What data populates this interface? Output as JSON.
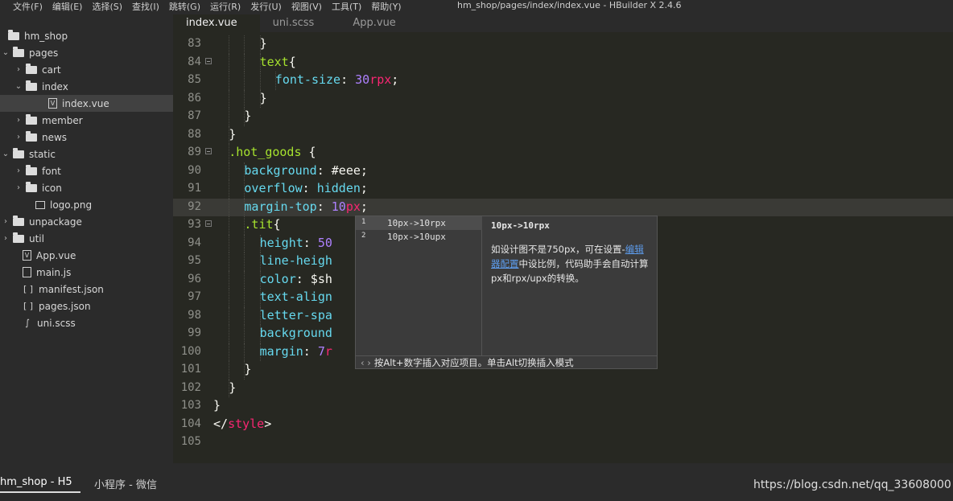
{
  "menu": [
    "文件(F)",
    "编辑(E)",
    "选择(S)",
    "查找(I)",
    "跳转(G)",
    "运行(R)",
    "发行(U)",
    "视图(V)",
    "工具(T)",
    "帮助(Y)"
  ],
  "window_title": "hm_shop/pages/index/index.vue - HBuilder X 2.4.6",
  "tabs": [
    "index.vue",
    "uni.scss",
    "App.vue"
  ],
  "tree": [
    {
      "label": "hm_shop",
      "type": "folder-open",
      "chev": "",
      "icon": "folder-icon"
    },
    {
      "label": "pages",
      "type": "folder-open",
      "chev": "⌄",
      "icon": "folder-open-icon"
    },
    {
      "label": "cart",
      "type": "folder",
      "chev": "›",
      "icon": "folder-icon"
    },
    {
      "label": "index",
      "type": "folder-open",
      "chev": "⌄",
      "icon": "folder-open-icon"
    },
    {
      "label": "index.vue",
      "type": "vue",
      "chev": "",
      "icon": "vue-file-icon"
    },
    {
      "label": "member",
      "type": "folder",
      "chev": "›",
      "icon": "folder-icon"
    },
    {
      "label": "news",
      "type": "folder",
      "chev": "›",
      "icon": "folder-icon"
    },
    {
      "label": "static",
      "type": "folder-open",
      "chev": "⌄",
      "icon": "folder-open-icon"
    },
    {
      "label": "font",
      "type": "folder",
      "chev": "›",
      "icon": "folder-icon"
    },
    {
      "label": "icon",
      "type": "folder",
      "chev": "›",
      "icon": "folder-icon"
    },
    {
      "label": "logo.png",
      "type": "img",
      "chev": "",
      "icon": "image-file-icon"
    },
    {
      "label": "unpackage",
      "type": "folder",
      "chev": "›",
      "icon": "folder-icon"
    },
    {
      "label": "util",
      "type": "folder",
      "chev": "›",
      "icon": "folder-icon"
    },
    {
      "label": "App.vue",
      "type": "vue",
      "chev": "",
      "icon": "vue-file-icon"
    },
    {
      "label": "main.js",
      "type": "js",
      "chev": "",
      "icon": "js-file-icon"
    },
    {
      "label": "manifest.json",
      "type": "json",
      "chev": "",
      "icon": "json-file-icon"
    },
    {
      "label": "pages.json",
      "type": "json",
      "chev": "",
      "icon": "json-file-icon"
    },
    {
      "label": "uni.scss",
      "type": "scss",
      "chev": "",
      "icon": "scss-file-icon"
    }
  ],
  "code_lines": [
    {
      "n": "83",
      "fold": false,
      "text": "}"
    },
    {
      "n": "84",
      "fold": true,
      "text": "text{"
    },
    {
      "n": "85",
      "fold": false,
      "text": "font-size: 30rpx;"
    },
    {
      "n": "86",
      "fold": false,
      "text": "}"
    },
    {
      "n": "87",
      "fold": false,
      "text": "}"
    },
    {
      "n": "88",
      "fold": false,
      "text": "}"
    },
    {
      "n": "89",
      "fold": true,
      "text": ".hot_goods {"
    },
    {
      "n": "90",
      "fold": false,
      "text": "background: #eee;"
    },
    {
      "n": "91",
      "fold": false,
      "text": "overflow: hidden;"
    },
    {
      "n": "92",
      "fold": false,
      "text": "margin-top: 10px;"
    },
    {
      "n": "93",
      "fold": true,
      "text": ".tit{"
    },
    {
      "n": "94",
      "fold": false,
      "text": "height: 50"
    },
    {
      "n": "95",
      "fold": false,
      "text": "line-heigh"
    },
    {
      "n": "96",
      "fold": false,
      "text": "color: $sh"
    },
    {
      "n": "97",
      "fold": false,
      "text": "text-align"
    },
    {
      "n": "98",
      "fold": false,
      "text": "letter-spa"
    },
    {
      "n": "99",
      "fold": false,
      "text": "background"
    },
    {
      "n": "100",
      "fold": false,
      "text": "margin: 7r"
    },
    {
      "n": "101",
      "fold": false,
      "text": "}"
    },
    {
      "n": "102",
      "fold": false,
      "text": "}"
    },
    {
      "n": "103",
      "fold": false,
      "text": "}"
    },
    {
      "n": "104",
      "fold": false,
      "text": "</style>"
    },
    {
      "n": "105",
      "fold": false,
      "text": ""
    }
  ],
  "autocomplete": {
    "items": [
      {
        "index": "1",
        "label": "10px->10rpx"
      },
      {
        "index": "2",
        "label": "10px->10upx"
      }
    ],
    "detail_title": "10px->10rpx",
    "detail_text_1": "如设计图不是750px，可在设置-",
    "detail_link": "编辑器配置",
    "detail_text_2": "中设比例，代码助手会自动计算px和rpx/upx的转换。",
    "footer_nav": "‹ ›",
    "footer": "按Alt+数字插入对应项目。单击Alt切换插入模式"
  },
  "bottom_tabs": [
    "hm_shop - H5",
    "小程序 - 微信"
  ],
  "watermark": "https://blog.csdn.net/qq_33608000"
}
